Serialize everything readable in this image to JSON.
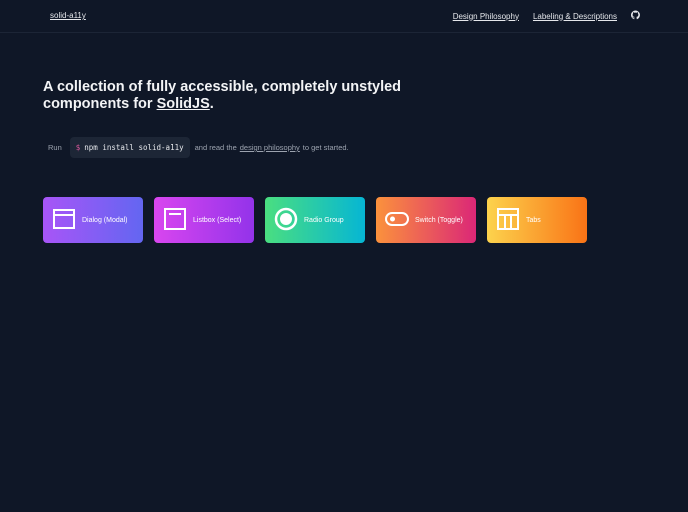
{
  "header": {
    "logo": "solid-a11y",
    "nav": [
      "Design Philosophy",
      "Labeling & Descriptions"
    ],
    "github_icon": "github-icon"
  },
  "hero": {
    "title_prefix": "A collection of fully accessible, completely unstyled components for ",
    "title_link": "SolidJS",
    "title_suffix": "."
  },
  "intro": {
    "run": "Run",
    "prompt": "$",
    "command": "npm install solid-a11y",
    "middle": "and read the",
    "link": "design philosophy",
    "end": "to get started."
  },
  "cards": [
    {
      "label": "Dialog (Modal)",
      "icon": "window-icon",
      "from": "#a855f7",
      "to": "#6366f1"
    },
    {
      "label": "Listbox (Select)",
      "icon": "listbox-icon",
      "from": "#d946ef",
      "to": "#9333ea"
    },
    {
      "label": "Radio Group",
      "icon": "radio-icon",
      "from": "#4ade80",
      "to": "#06b6d4"
    },
    {
      "label": "Switch (Toggle)",
      "icon": "switch-icon",
      "from": "#fb923c",
      "to": "#db2777"
    },
    {
      "label": "Tabs",
      "icon": "tabs-icon",
      "from": "#fcd34d",
      "to": "#f97316"
    }
  ]
}
